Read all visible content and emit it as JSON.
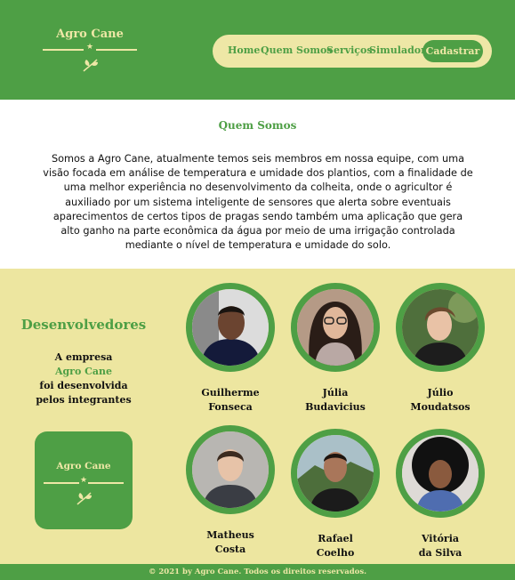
{
  "header": {
    "logo_text": "Agro Cane",
    "nav": [
      "Home",
      "Quem Somos",
      "Serviços",
      "Simulador"
    ],
    "cta_label": "Cadastrar"
  },
  "about": {
    "title": "Quem Somos",
    "text": "Somos a Agro Cane, atualmente temos seis membros em nossa equipe, com uma visão focada em análise de temperatura e umidade dos plantios, com a finalidade de uma melhor experiência no desenvolvimento da colheita, onde o agricultor é auxiliado por um sistema inteligente de sensores que alerta sobre eventuais aparecimentos de certos tipos de pragas sendo também uma aplicação que gera alto ganho na parte econômica da água por meio de uma irrigação controlada mediante o nível de temperatura e umidade do solo."
  },
  "devs": {
    "title": "Desenvolvedores",
    "desc_line1": "A empresa",
    "desc_company": "Agro Cane",
    "desc_line3": "foi desenvolvida",
    "desc_line4": "pelos integrantes",
    "logo_text": "Agro Cane",
    "members": [
      {
        "first": "Guilherme",
        "last": "Fonseca"
      },
      {
        "first": "Júlia",
        "last": "Budavicius"
      },
      {
        "first": "Júlio",
        "last": "Moudatsos"
      },
      {
        "first": "Matheus",
        "last": "Costa"
      },
      {
        "first": "Rafael",
        "last": "Coelho"
      },
      {
        "first": "Vitória",
        "last": "da Silva"
      }
    ]
  },
  "footer": {
    "text": "© 2021 by Agro Cane. Todos os direitos reservados."
  },
  "colors": {
    "primary_green": "#4e9f45",
    "cream": "#eee7a6",
    "section_bg": "#ede6a0"
  },
  "icons": [
    "leaf-icon",
    "star-icon"
  ]
}
